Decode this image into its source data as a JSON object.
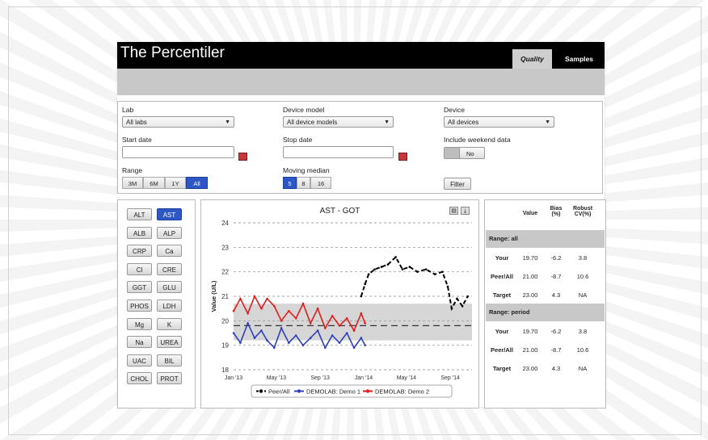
{
  "app": {
    "title": "The Percentiler"
  },
  "tabs": [
    {
      "label": "Quality"
    },
    {
      "label": "Samples"
    }
  ],
  "filters": {
    "lab": {
      "label": "Lab",
      "value": "All labs"
    },
    "device_model": {
      "label": "Device model",
      "value": "All device models"
    },
    "device": {
      "label": "Device",
      "value": "All devices"
    },
    "start_date": {
      "label": "Start date",
      "value": ""
    },
    "stop_date": {
      "label": "Stop date",
      "value": ""
    },
    "weekend": {
      "label": "Include weekend data",
      "value": "No"
    },
    "range": {
      "label": "Range",
      "options": [
        "3M",
        "6M",
        "1Y",
        "All"
      ],
      "selected": "All"
    },
    "moving_median": {
      "label": "Moving median",
      "options": [
        "5",
        "8",
        "16"
      ],
      "selected": "5"
    },
    "filter_button": "Filter"
  },
  "analytes": [
    "ALT",
    "AST",
    "ALB",
    "ALP",
    "CRP",
    "Ca",
    "Cl",
    "CRE",
    "GGT",
    "GLU",
    "PHOS",
    "LDH",
    "Mg",
    "K",
    "Na",
    "UREA",
    "UAC",
    "BIL",
    "CHOL",
    "PROT"
  ],
  "selected_analyte": "AST",
  "icons": {
    "print": "print-icon",
    "download": "download-icon",
    "calendar": "calendar-icon",
    "dropdown": "chevron-down-icon"
  },
  "colors": {
    "accent": "#2e57c6",
    "peer": "#000000",
    "demo1": "#2d3fc0",
    "demo2": "#e41b1b",
    "band": "#d6d6d6"
  },
  "table": {
    "headers": [
      "Value",
      "Bias (%)",
      "Robust CV(%)"
    ],
    "sections": [
      {
        "title": "Range: all",
        "rows": [
          {
            "label": "Your",
            "value": "19.70",
            "bias": "-6.2",
            "cv": "3.8"
          },
          {
            "label": "Peer/All",
            "value": "21.00",
            "bias": "-8.7",
            "cv": "10.6"
          },
          {
            "label": "Target",
            "value": "23.00",
            "bias": "4.3",
            "cv": "NA"
          }
        ]
      },
      {
        "title": "Range: period",
        "rows": [
          {
            "label": "Your",
            "value": "19.70",
            "bias": "-6.2",
            "cv": "3.8"
          },
          {
            "label": "Peer/All",
            "value": "21.00",
            "bias": "-8.7",
            "cv": "10.6"
          },
          {
            "label": "Target",
            "value": "23.00",
            "bias": "4.3",
            "cv": "NA"
          }
        ]
      }
    ]
  },
  "chart_data": {
    "type": "line",
    "title": "AST - GOT",
    "ylabel": "Value (U/L)",
    "ylim": [
      18,
      24
    ],
    "yticks": [
      18,
      19,
      20,
      21,
      22,
      23,
      24
    ],
    "xlim": [
      "2013-01-01",
      "2014-11-01"
    ],
    "xticks": [
      "Jan '13",
      "May '13",
      "Sep '13",
      "Jan '14",
      "May '14",
      "Sep '14"
    ],
    "xtick_dates": [
      "2013-01-01",
      "2013-05-01",
      "2013-09-01",
      "2014-01-01",
      "2014-05-01",
      "2014-09-01"
    ],
    "grid": "horizontal dashed",
    "legend_position": "bottom",
    "band": {
      "low": 19.2,
      "high": 20.7,
      "mid_line": 19.8
    },
    "series": [
      {
        "name": "Peer/All",
        "color": "#000000",
        "style": "dashed",
        "points": [
          [
            "2013-12-25",
            21.0
          ],
          [
            "2014-01-05",
            21.5
          ],
          [
            "2014-01-15",
            21.9
          ],
          [
            "2014-02-01",
            22.1
          ],
          [
            "2014-02-20",
            22.2
          ],
          [
            "2014-03-10",
            22.3
          ],
          [
            "2014-04-01",
            22.6
          ],
          [
            "2014-04-20",
            22.1
          ],
          [
            "2014-05-10",
            22.2
          ],
          [
            "2014-06-01",
            22.0
          ],
          [
            "2014-06-25",
            22.1
          ],
          [
            "2014-07-20",
            21.9
          ],
          [
            "2014-08-10",
            22.0
          ],
          [
            "2014-08-25",
            21.4
          ],
          [
            "2014-09-05",
            20.5
          ],
          [
            "2014-09-20",
            20.9
          ],
          [
            "2014-10-05",
            20.6
          ],
          [
            "2014-10-20",
            21.0
          ]
        ]
      },
      {
        "name": "DEMOLAB: Demo 1",
        "color": "#2d3fc0",
        "style": "solid",
        "points": [
          [
            "2013-01-01",
            19.5
          ],
          [
            "2013-01-20",
            19.1
          ],
          [
            "2013-02-10",
            19.9
          ],
          [
            "2013-03-01",
            19.3
          ],
          [
            "2013-03-20",
            19.6
          ],
          [
            "2013-04-05",
            19.2
          ],
          [
            "2013-04-25",
            18.9
          ],
          [
            "2013-05-15",
            19.7
          ],
          [
            "2013-06-05",
            19.1
          ],
          [
            "2013-06-25",
            19.4
          ],
          [
            "2013-07-15",
            19.0
          ],
          [
            "2013-08-05",
            19.3
          ],
          [
            "2013-08-25",
            19.6
          ],
          [
            "2013-09-15",
            18.9
          ],
          [
            "2013-10-05",
            19.4
          ],
          [
            "2013-10-25",
            19.1
          ],
          [
            "2013-11-15",
            19.5
          ],
          [
            "2013-12-05",
            18.9
          ],
          [
            "2013-12-25",
            19.3
          ],
          [
            "2014-01-05",
            19.0
          ]
        ]
      },
      {
        "name": "DEMOLAB: Demo 2",
        "color": "#e41b1b",
        "style": "solid",
        "points": [
          [
            "2013-01-01",
            20.4
          ],
          [
            "2013-01-20",
            20.9
          ],
          [
            "2013-02-10",
            20.3
          ],
          [
            "2013-03-01",
            21.0
          ],
          [
            "2013-03-20",
            20.5
          ],
          [
            "2013-04-05",
            20.9
          ],
          [
            "2013-04-25",
            20.6
          ],
          [
            "2013-05-15",
            20.0
          ],
          [
            "2013-06-05",
            20.4
          ],
          [
            "2013-06-25",
            20.1
          ],
          [
            "2013-07-15",
            20.7
          ],
          [
            "2013-08-05",
            19.9
          ],
          [
            "2013-08-25",
            20.5
          ],
          [
            "2013-09-15",
            19.7
          ],
          [
            "2013-10-05",
            20.2
          ],
          [
            "2013-10-25",
            19.8
          ],
          [
            "2013-11-15",
            20.1
          ],
          [
            "2013-12-05",
            19.6
          ],
          [
            "2013-12-25",
            20.3
          ],
          [
            "2014-01-05",
            19.9
          ]
        ]
      }
    ]
  }
}
